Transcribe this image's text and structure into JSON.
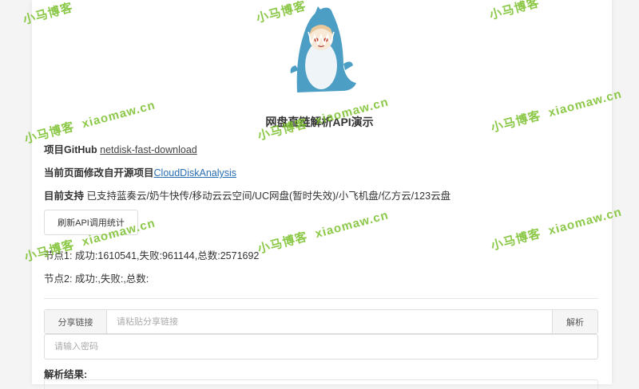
{
  "title": "网盘直链解析API演示",
  "github": {
    "label": "项目GitHub",
    "link_text": "netdisk-fast-download"
  },
  "source": {
    "label": "当前页面修改自开源项目",
    "link_text": "CloudDiskAnalysis"
  },
  "support": {
    "label": "目前支持",
    "text": "已支持蓝奏云/奶牛快传/移动云云空间/UC网盘(暂时失效)/小飞机盘/亿方云/123云盘"
  },
  "refresh_button": "刷新API调用统计",
  "node1": "节点1: 成功:1610541,失败:961144,总数:2571692",
  "node2": "节点2: 成功:,失败:,总数:",
  "share": {
    "addon": "分享链接",
    "placeholder": "请粘贴分享链接",
    "parse": "解析"
  },
  "password": {
    "placeholder": "请输入密码"
  },
  "result_label": "解析结果:",
  "watermarks": {
    "site": "小马博客",
    "domain": "xiaomaw.cn"
  },
  "colors": {
    "link": "#2a6fb2",
    "watermark": "#78be28",
    "mascot_blue": "#4d9ec4"
  },
  "icons": [
    "shark-mascot-icon"
  ]
}
